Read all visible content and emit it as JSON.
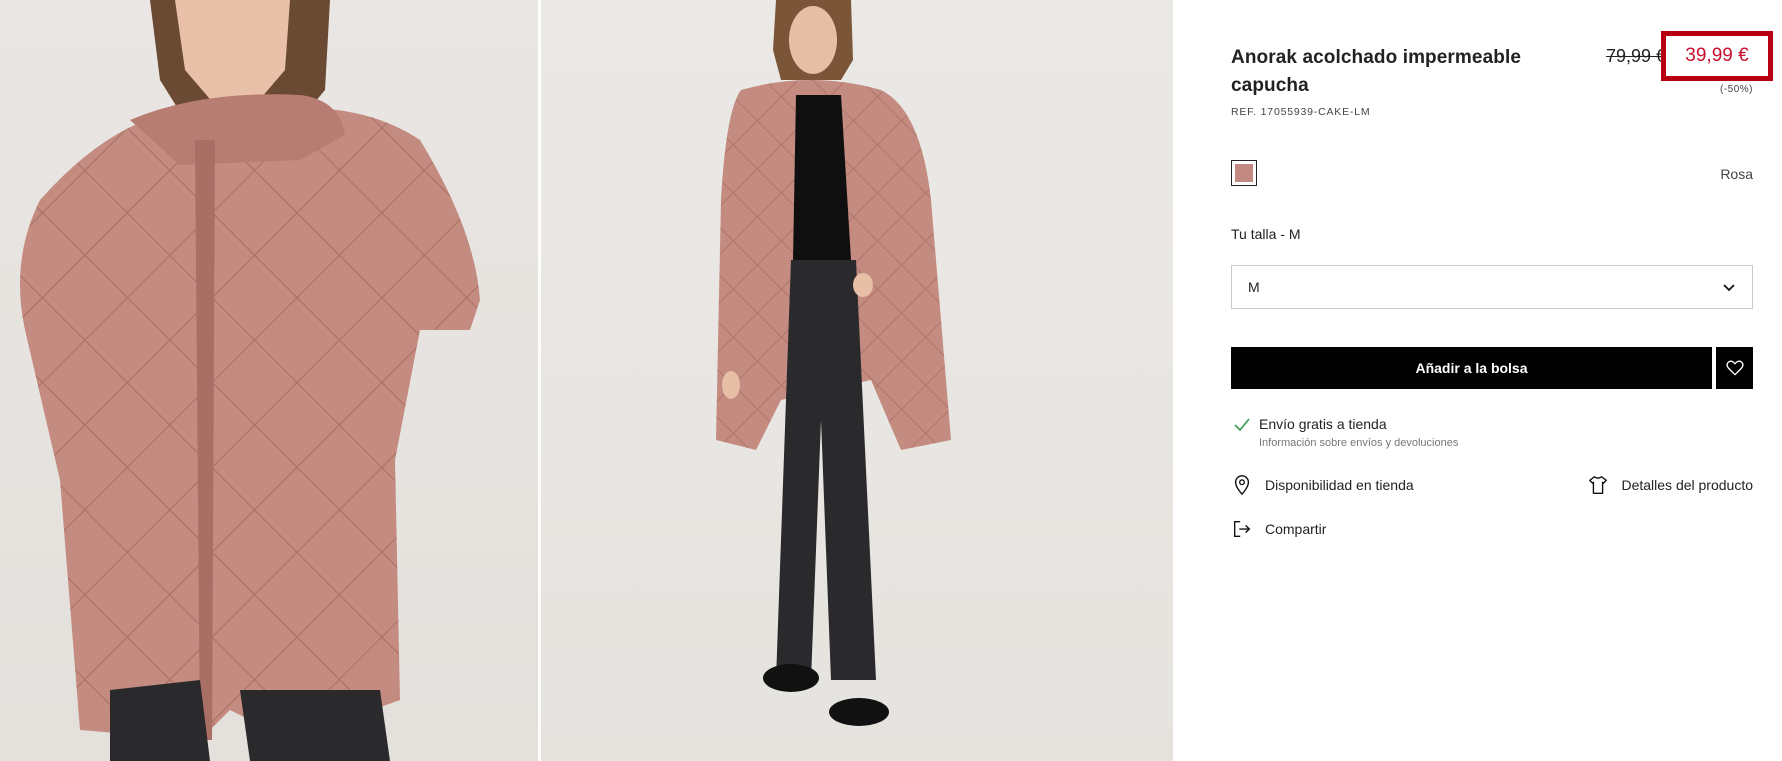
{
  "product": {
    "title": "Anorak acolchado impermeable capucha",
    "ref": "REF. 17055939-CAKE-LM",
    "price_old": "79,99 €",
    "price_new": "39,99 €",
    "discount": "(-50%)",
    "color_name": "Rosa",
    "swatch_color": "#c28a82",
    "highlight_color": "#b70012"
  },
  "size": {
    "label": "Tu talla - M",
    "selected": "M"
  },
  "actions": {
    "add_to_bag": "Añadir a la bolsa",
    "shipping_title": "Envío gratis a tienda",
    "shipping_link": "Información sobre envíos y devoluciones",
    "store_availability": "Disponibilidad en tienda",
    "product_details": "Detalles del producto",
    "share": "Compartir"
  },
  "icons": {
    "favorite": "heart-icon",
    "dropdown": "chevron-down-icon",
    "check": "check-icon",
    "location": "location-pin-icon",
    "details": "tshirt-icon",
    "share": "share-exit-icon"
  }
}
